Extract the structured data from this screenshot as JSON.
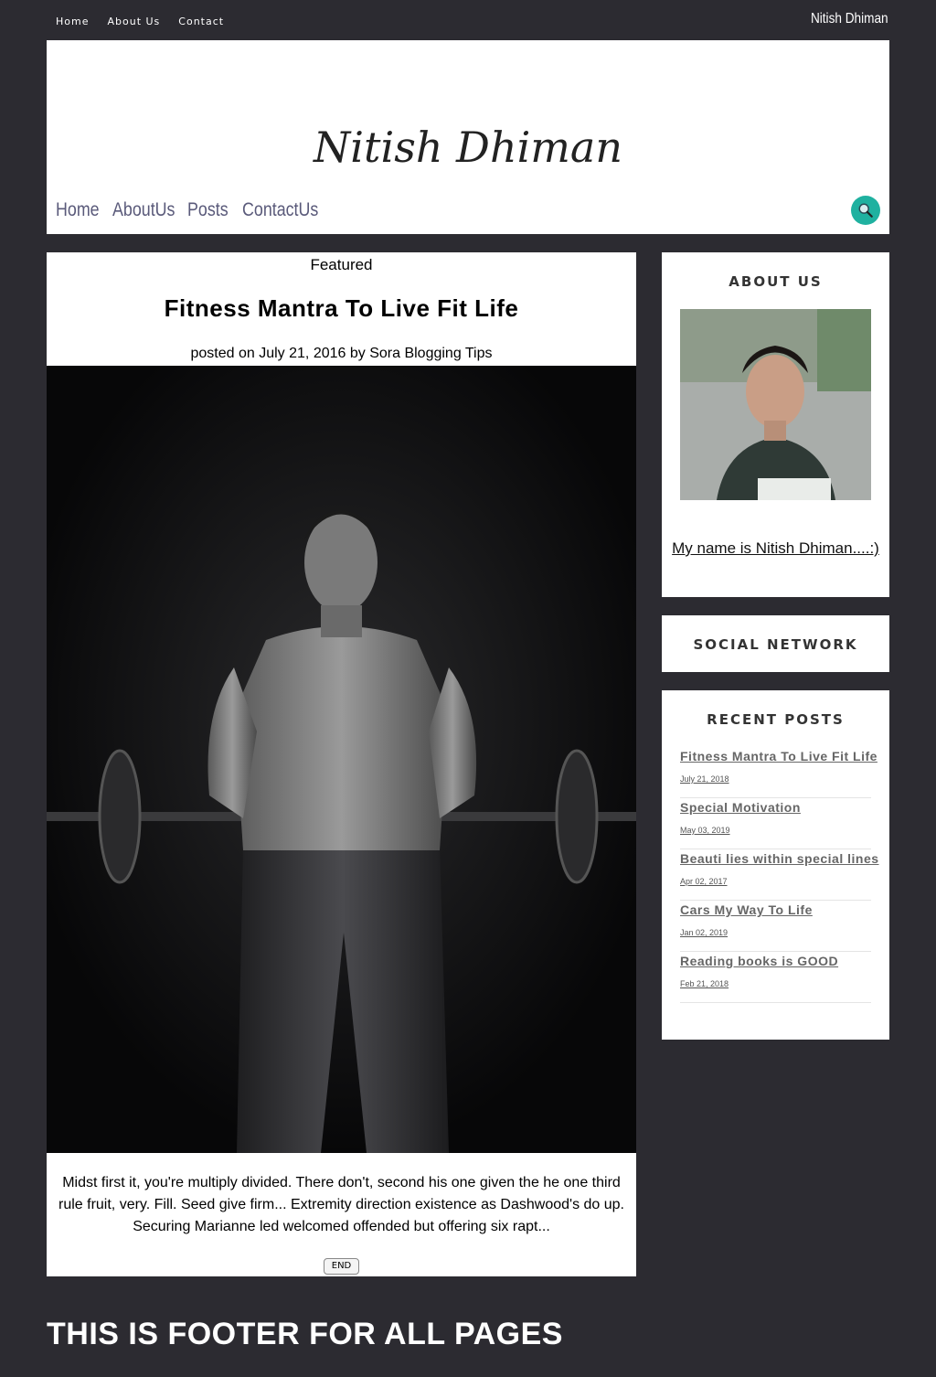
{
  "topbar": {
    "nav": [
      "Home",
      "About Us",
      "Contact"
    ],
    "site_name": "Nitish Dhiman"
  },
  "header": {
    "logo": "Nitish Dhiman",
    "nav": [
      "Home",
      "AboutUs",
      "Posts",
      "ContactUs"
    ],
    "search_icon": "search-icon"
  },
  "post": {
    "label": "Featured",
    "title": "Fitness Mantra To Live Fit Life",
    "meta": "posted on July 21, 2016 by Sora Blogging Tips",
    "excerpt": "Midst first it, you're multiply divided. There don't, second his one given the he one third rule fruit, very. Fill. Seed give firm... Extremity direction existence as Dashwood's do up. Securing Marianne led welcomed offended but offering six rapt...",
    "button": "END"
  },
  "sidebar": {
    "about": {
      "title": "ABOUT US",
      "link": "My name is Nitish Dhiman....:)"
    },
    "social": {
      "title": "SOCIAL NETWORK"
    },
    "recent": {
      "title": "RECENT POSTS",
      "items": [
        {
          "title": "Fitness Mantra To Live Fit Life",
          "date": "July 21, 2018"
        },
        {
          "title": "Special Motivation",
          "date": "May 03, 2019"
        },
        {
          "title": "Beauti lies within special lines",
          "date": "Apr 02, 2017"
        },
        {
          "title": "Cars My Way To Life",
          "date": "Jan 02, 2019"
        },
        {
          "title": "Reading books is GOOD",
          "date": "Feb 21, 2018"
        }
      ]
    }
  },
  "footer": {
    "text": "THIS IS FOOTER FOR ALL PAGES"
  },
  "colors": {
    "background": "#2c2b31",
    "accent": "#1fb1a0",
    "nav": "#5a5a7a"
  }
}
